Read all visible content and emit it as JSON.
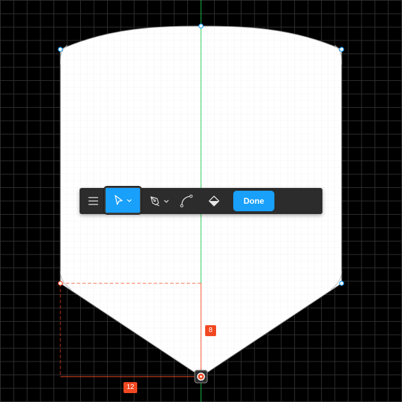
{
  "toolbar": {
    "done_label": "Done",
    "accent_color": "#18a0fb",
    "tools": [
      {
        "name": "menu",
        "icon": "hamburger-menu-icon"
      },
      {
        "name": "move",
        "icon": "cursor-arrow-icon",
        "active": true,
        "has_dropdown": true
      },
      {
        "name": "pen",
        "icon": "pen-icon",
        "has_dropdown": true
      },
      {
        "name": "bend",
        "icon": "bend-tool-icon"
      },
      {
        "name": "paint-bucket",
        "icon": "paint-bucket-icon"
      }
    ]
  },
  "measurements": {
    "vertical": "8",
    "horizontal": "12",
    "color": "#f24822"
  },
  "canvas": {
    "background_color": "#000000",
    "shape_fill": "#ffffff",
    "center_guide_color": "#1bc44f"
  }
}
